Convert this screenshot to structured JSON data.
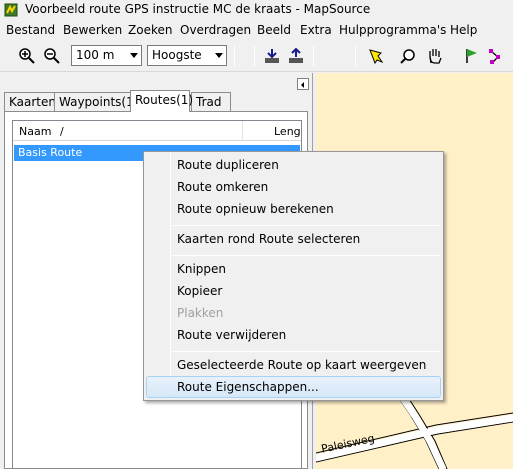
{
  "window": {
    "title": "Voorbeeld route GPS instructie MC de kraats - MapSource"
  },
  "menu": {
    "items": [
      "Bestand",
      "Bewerken",
      "Zoeken",
      "Overdragen",
      "Beeld",
      "Extra",
      "Hulpprogramma's",
      "Help"
    ]
  },
  "toolbar": {
    "zoom_in_icon": "zoom-in-icon",
    "zoom_out_icon": "zoom-out-icon",
    "scale_value": "100 m",
    "detail_value": "Hoogste",
    "icons": [
      "receive-from-device-icon",
      "send-to-device-icon",
      "select-tool-icon",
      "zoom-tool-icon",
      "hand-tool-icon",
      "waypoint-tool-icon",
      "route-tool-icon"
    ]
  },
  "tabs": [
    "Kaarten",
    "Waypoints(1)",
    "Routes(1)",
    "Trad"
  ],
  "active_tab": "Routes(1)",
  "list": {
    "columns": [
      "Naam",
      "Leng"
    ],
    "sort_indicator": "/",
    "rows": [
      {
        "name": "Basis Route",
        "selected": true
      }
    ]
  },
  "map": {
    "street_label": "Paleisweg"
  },
  "context_menu": {
    "items": [
      {
        "label": "Route dupliceren",
        "disabled": false
      },
      {
        "label": "Route omkeren",
        "disabled": false
      },
      {
        "label": "Route opnieuw berekenen",
        "disabled": false
      },
      {
        "label": "Kaarten rond Route selecteren",
        "disabled": false
      },
      {
        "label": "Knippen",
        "disabled": false
      },
      {
        "label": "Kopieer",
        "disabled": false
      },
      {
        "label": "Plakken",
        "disabled": true
      },
      {
        "label": "Route verwijderen",
        "disabled": false
      },
      {
        "label": "Geselecteerde Route op kaart weergeven",
        "disabled": false
      },
      {
        "label": "Route Eigenschappen...",
        "disabled": false
      }
    ],
    "highlighted": "Route Eigenschappen..."
  },
  "colors": {
    "selection": "#3399ff",
    "map_background": "#fff0c8",
    "menu_highlight_border": "#a8d2f5"
  }
}
